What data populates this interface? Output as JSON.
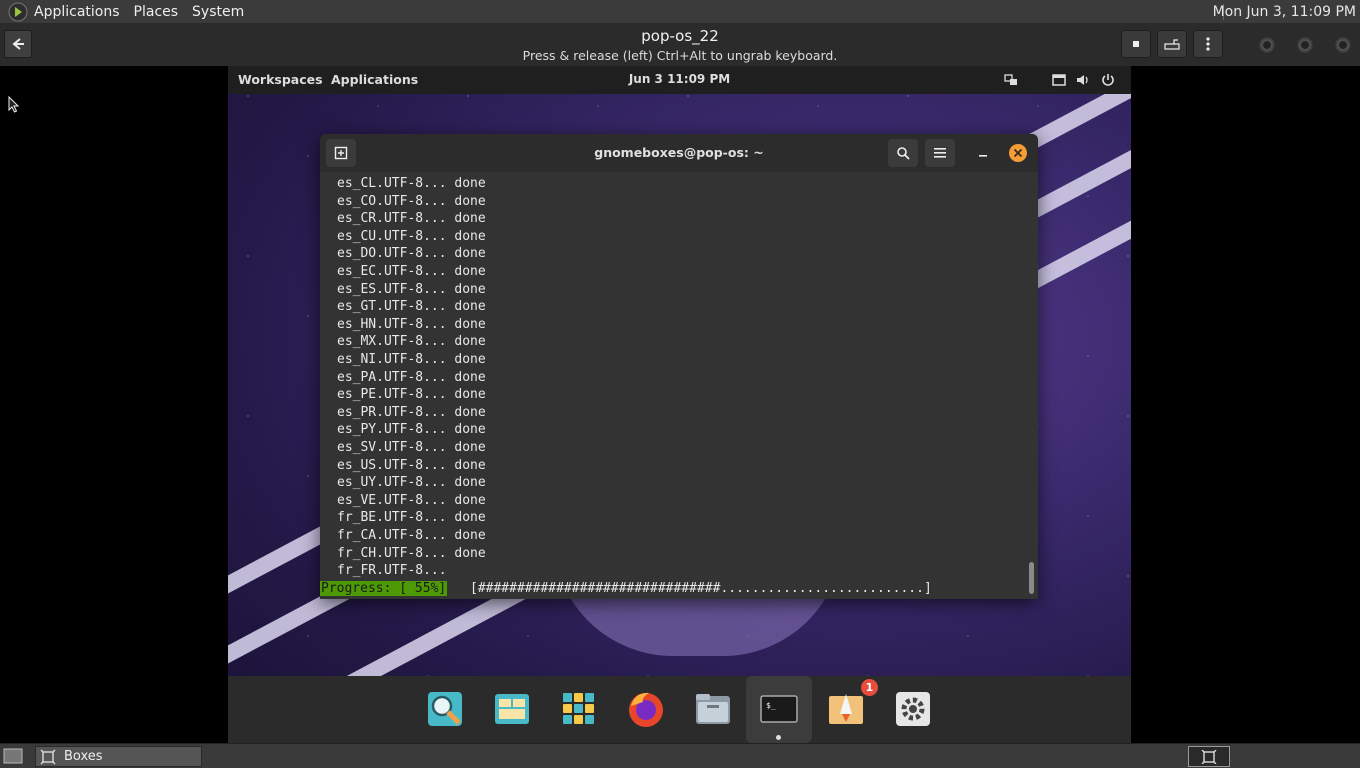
{
  "host": {
    "menus": [
      "Applications",
      "Places",
      "System"
    ],
    "clock": "Mon Jun  3, 11:09 PM"
  },
  "boxes": {
    "title": "pop-os_22",
    "subtitle": "Press & release (left) Ctrl+Alt to ungrab keyboard."
  },
  "vm_panel": {
    "workspaces": "Workspaces",
    "applications": "Applications",
    "clock": "Jun 3   11:09 PM"
  },
  "terminal": {
    "title": "gnomeboxes@pop-os: ~",
    "lines": [
      "es_CL.UTF-8... done",
      "es_CO.UTF-8... done",
      "es_CR.UTF-8... done",
      "es_CU.UTF-8... done",
      "es_DO.UTF-8... done",
      "es_EC.UTF-8... done",
      "es_ES.UTF-8... done",
      "es_GT.UTF-8... done",
      "es_HN.UTF-8... done",
      "es_MX.UTF-8... done",
      "es_NI.UTF-8... done",
      "es_PA.UTF-8... done",
      "es_PE.UTF-8... done",
      "es_PR.UTF-8... done",
      "es_PY.UTF-8... done",
      "es_SV.UTF-8... done",
      "es_US.UTF-8... done",
      "es_UY.UTF-8... done",
      "es_VE.UTF-8... done",
      "fr_BE.UTF-8... done",
      "fr_CA.UTF-8... done",
      "fr_CH.UTF-8... done",
      "fr_FR.UTF-8..."
    ],
    "progress_label": "Progress: [ 55%]",
    "progress_bar": "[###############################..........................]"
  },
  "dock": {
    "badge": "1"
  },
  "taskbar": {
    "window_label": "Boxes"
  },
  "colors": {
    "terminal_bg": "#333333",
    "progress_green": "#4e9a06",
    "close_orange": "#f39c38",
    "badge_red": "#e74c3c"
  }
}
